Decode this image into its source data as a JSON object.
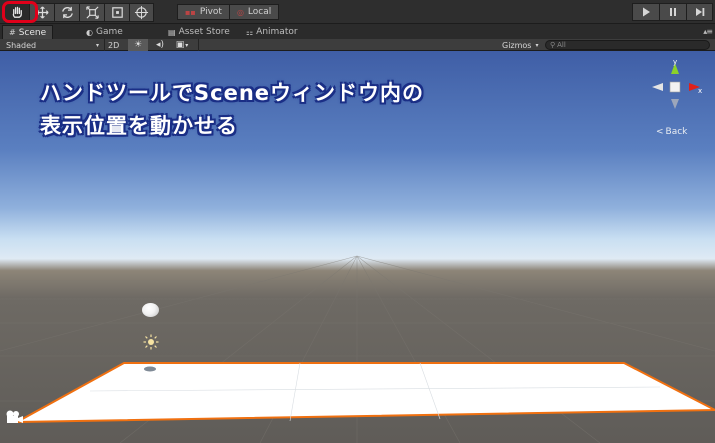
{
  "toolbar": {
    "tools": [
      "hand-tool",
      "move-tool",
      "rotate-tool",
      "scale-tool",
      "rect-tool",
      "transform-tool"
    ],
    "pivot_label": "Pivot",
    "local_label": "Local"
  },
  "tabs": {
    "scene": "Scene",
    "game": "Game",
    "asset_store": "Asset Store",
    "animator": "Animator"
  },
  "scene_bar": {
    "shading_mode": "Shaded",
    "mode_2d": "2D",
    "gizmos_label": "Gizmos",
    "search_placeholder": "All"
  },
  "viewport": {
    "caption_line1": "ハンドツールでSceneウィンドウ内の",
    "caption_line2": "表示位置を動かせる",
    "gizmo_x_label": "x",
    "gizmo_y_label": "y",
    "back_label": "Back"
  },
  "colors": {
    "highlight": "#e0001a",
    "plane_outline": "#f07010",
    "caption_outline": "#1b2f86"
  }
}
